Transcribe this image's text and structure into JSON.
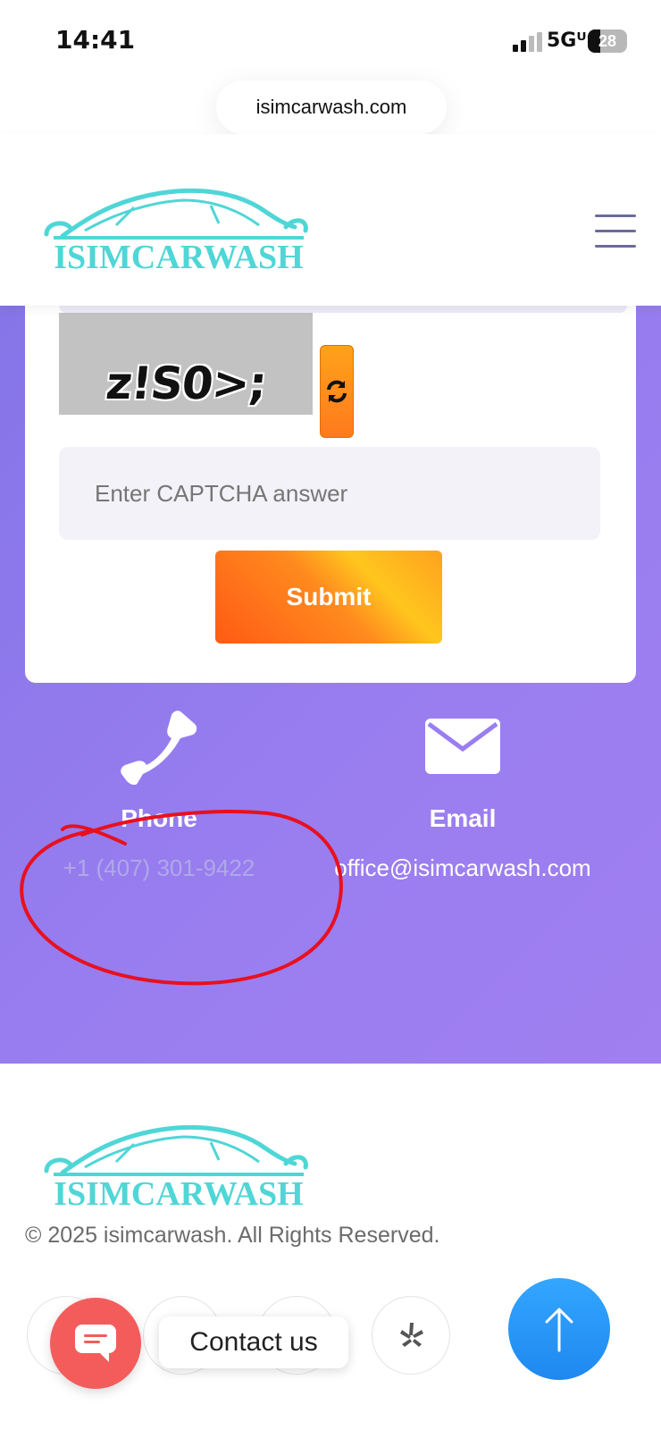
{
  "status_bar": {
    "time": "14:41",
    "network": "5Gᵁᶜ",
    "battery": "28"
  },
  "browser": {
    "url": "isimcarwash.com"
  },
  "header": {
    "logo_text": "ISIMCARWASH"
  },
  "captcha": {
    "code": "z!S0>;",
    "input_placeholder": "Enter CAPTCHA answer",
    "submit_label": "Submit"
  },
  "contact": {
    "phone_label": "Phone",
    "phone_value": "+1 (407) 301-9422",
    "email_label": "Email",
    "email_value": "office@isimcarwash.com"
  },
  "footer": {
    "logo_text": "ISIMCARWASH",
    "copyright": "© 2025 isimcarwash. All Rights Reserved."
  },
  "widgets": {
    "contact_us_label": "Contact us"
  },
  "colors": {
    "accent_purple": "#8f78ec",
    "logo_teal": "#4fd6d6",
    "submit_orange": "#ff8a1e",
    "annotation_red": "#e8101e",
    "scroll_blue": "#2b98f5",
    "chat_red": "#f45c5c"
  },
  "icons": [
    "refresh-icon",
    "phone-icon",
    "email-icon",
    "yelp-icon",
    "chat-icon",
    "arrow-up-icon",
    "menu-icon"
  ]
}
